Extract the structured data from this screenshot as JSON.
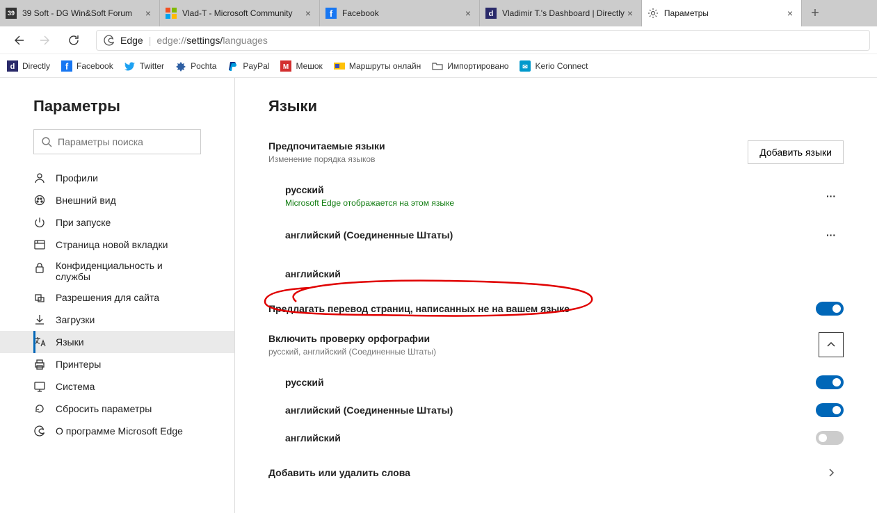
{
  "tabs": [
    {
      "title": "39 Soft - DG Win&Soft Forum",
      "active": false
    },
    {
      "title": "Vlad-T - Microsoft Community",
      "active": false
    },
    {
      "title": "Facebook",
      "active": false
    },
    {
      "title": "Vladimir T.'s Dashboard | Directly",
      "active": false
    },
    {
      "title": "Параметры",
      "active": true
    }
  ],
  "address": {
    "label": "Edge",
    "proto": "edge://",
    "path1": "settings/",
    "path2": "languages"
  },
  "bookmarks": [
    {
      "label": "Directly"
    },
    {
      "label": "Facebook"
    },
    {
      "label": "Twitter"
    },
    {
      "label": "Pochta"
    },
    {
      "label": "PayPal"
    },
    {
      "label": "Мешок"
    },
    {
      "label": "Маршруты онлайн"
    },
    {
      "label": "Импортировано"
    },
    {
      "label": "Kerio Connect"
    }
  ],
  "sidebar": {
    "title": "Параметры",
    "search_placeholder": "Параметры поиска",
    "items": [
      {
        "label": "Профили"
      },
      {
        "label": "Внешний вид"
      },
      {
        "label": "При запуске"
      },
      {
        "label": "Страница новой вкладки"
      },
      {
        "label": "Конфиденциальность и службы"
      },
      {
        "label": "Разрешения для сайта"
      },
      {
        "label": "Загрузки"
      },
      {
        "label": "Языки"
      },
      {
        "label": "Принтеры"
      },
      {
        "label": "Система"
      },
      {
        "label": "Сбросить параметры"
      },
      {
        "label": "О программе Microsoft Edge"
      }
    ]
  },
  "content": {
    "title": "Языки",
    "preferred": {
      "title": "Предпочитаемые языки",
      "subtitle": "Изменение порядка языков",
      "add_button": "Добавить языки",
      "languages": [
        {
          "name": "русский",
          "note": "Microsoft Edge отображается на этом языке"
        },
        {
          "name": "английский (Соединенные Штаты)",
          "note": ""
        },
        {
          "name": "английский",
          "note": ""
        }
      ]
    },
    "translate": {
      "title": "Предлагать перевод страниц, написанных не на вашем языке"
    },
    "spellcheck": {
      "title": "Включить проверку орфографии",
      "subtitle": "русский, английский (Соединенные Штаты)",
      "languages": [
        {
          "name": "русский",
          "on": true
        },
        {
          "name": "английский (Соединенные Штаты)",
          "on": true
        },
        {
          "name": "английский",
          "on": false
        }
      ],
      "dictionary": "Добавить или удалить слова"
    }
  }
}
